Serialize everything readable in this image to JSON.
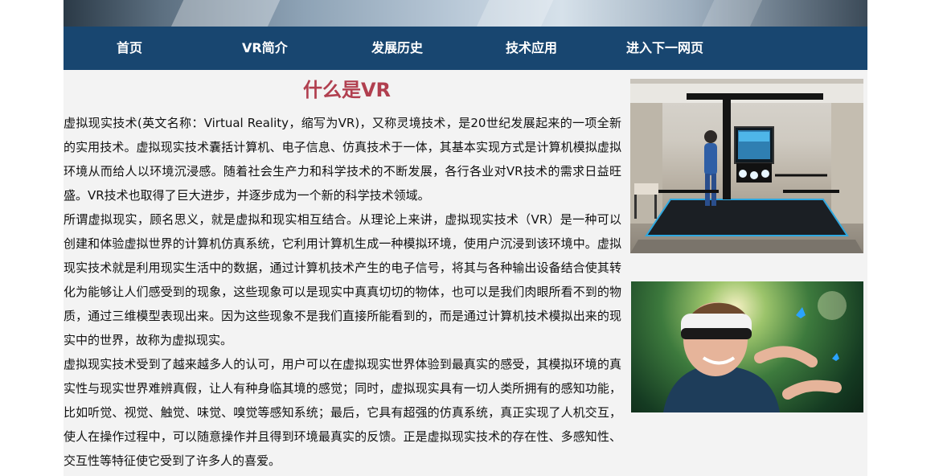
{
  "nav": {
    "items": [
      {
        "label": "首页"
      },
      {
        "label": "VR简介"
      },
      {
        "label": "发展历史"
      },
      {
        "label": "技术应用"
      },
      {
        "label": "进入下一网页"
      }
    ]
  },
  "main": {
    "title": "什么是VR",
    "paragraphs": [
      "虚拟现实技术(英文名称：Virtual Reality，缩写为VR)，又称灵境技术，是20世纪发展起来的一项全新的实用技术。虚拟现实技术囊括计算机、电子信息、仿真技术于一体，其基本实现方式是计算机模拟虚拟环境从而给人以环境沉浸感。随着社会生产力和科学技术的不断发展，各行各业对VR技术的需求日益旺盛。VR技术也取得了巨大进步，并逐步成为一个新的科学技术领域。",
      "所谓虚拟现实，顾名思义，就是虚拟和现实相互结合。从理论上来讲，虚拟现实技术（VR）是一种可以创建和体验虚拟世界的计算机仿真系统，它利用计算机生成一种模拟环境，使用户沉浸到该环境中。虚拟现实技术就是利用现实生活中的数据，通过计算机技术产生的电子信号，将其与各种输出设备结合使其转化为能够让人们感受到的现象，这些现象可以是现实中真真切切的物体，也可以是我们肉眼所看不到的物质，通过三维模型表现出来。因为这些现象不是我们直接所能看到的，而是通过计算机技术模拟出来的现实中的世界，故称为虚拟现实。",
      "虚拟现实技术受到了越来越多人的认可，用户可以在虚拟现实世界体验到最真实的感受，其模拟环境的真实性与现实世界难辨真假，让人有种身临其境的感觉；同时，虚拟现实具有一切人类所拥有的感知功能，比如听觉、视觉、触觉、味觉、嗅觉等感知系统；最后，它具有超强的仿真系统，真正实现了人机交互，使人在操作过程中，可以随意操作并且得到环境最真实的反馈。正是虚拟现实技术的存在性、多感知性、交互性等特征使它受到了许多人的喜爱。"
    ]
  },
  "colors": {
    "nav_bg": "#184670",
    "title": "#b13f4f",
    "content_bg": "#f3f3f3"
  }
}
